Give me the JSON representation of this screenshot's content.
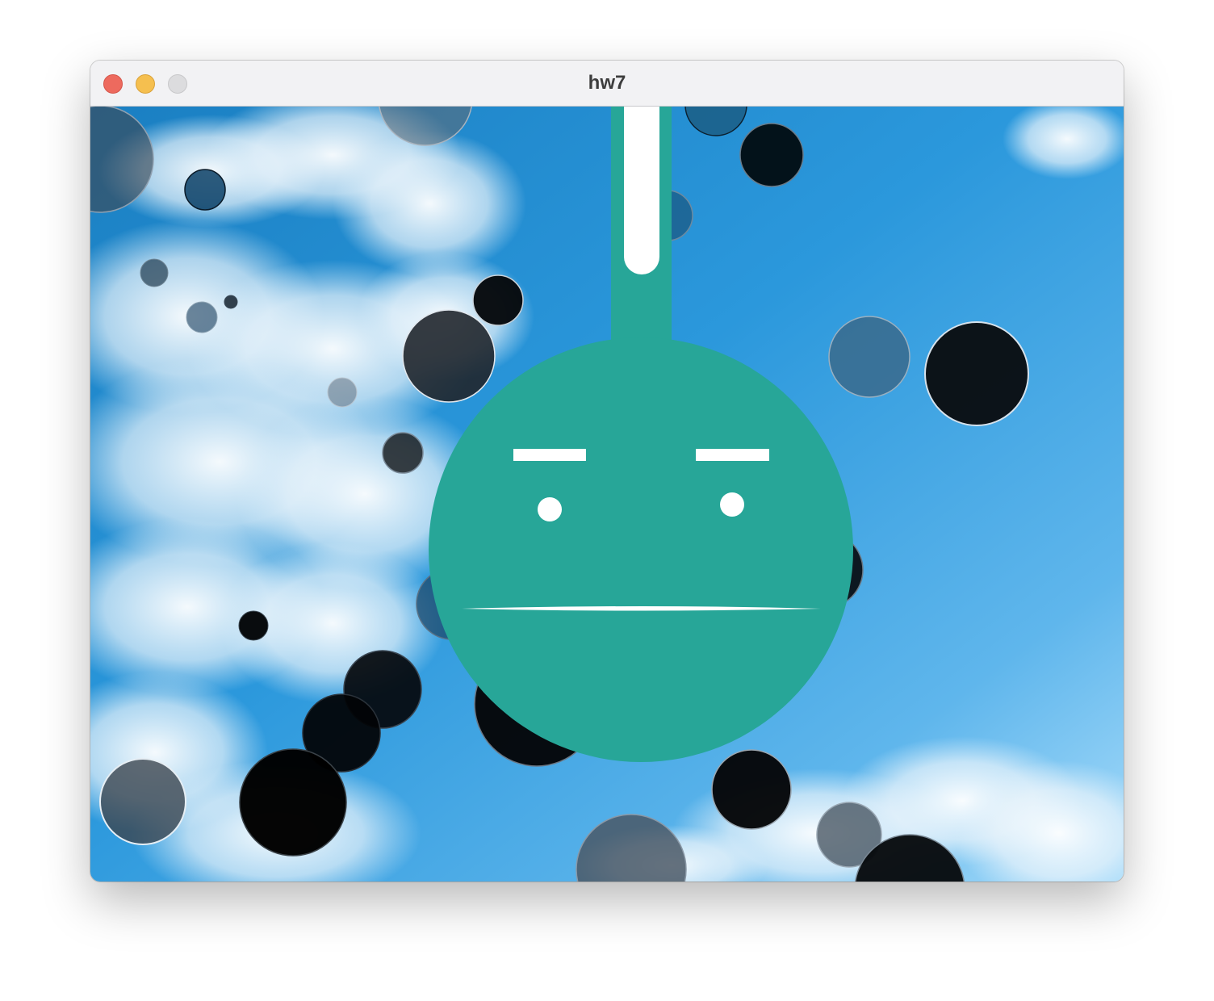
{
  "window": {
    "title": "hw7",
    "controls": {
      "close_color": "#ed6a5e",
      "minimize_color": "#f5bf4f",
      "zoom_color": "#dcdcde"
    }
  },
  "scene": {
    "background": "sky-with-clouds",
    "face_color": "#27a698",
    "feature_color": "#ffffff",
    "bubble_colors": [
      "#0a0f14",
      "#1c2733",
      "#4a6a88",
      "#8a9aa8"
    ],
    "sky_colors": [
      "#1e86c8",
      "#2f9ae0",
      "#7cc3f0"
    ]
  }
}
